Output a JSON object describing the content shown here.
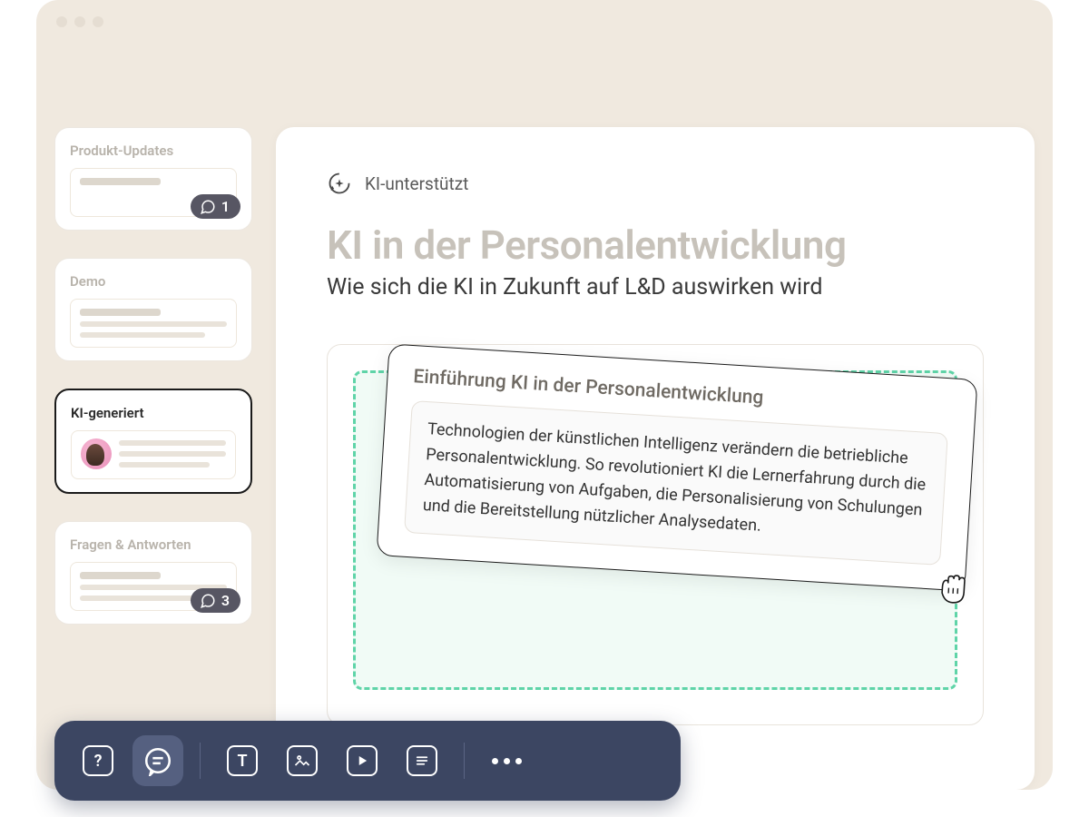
{
  "sidebar": {
    "items": [
      {
        "title": "Produkt-Updates",
        "comment_count": "1"
      },
      {
        "title": "Demo"
      },
      {
        "title": "KI-generiert"
      },
      {
        "title": "Fragen & Antworten",
        "comment_count": "3"
      }
    ]
  },
  "main": {
    "tag_label": "KI-unterstützt",
    "title": "KI in der Personalentwicklung",
    "subtitle": "Wie sich die KI in Zukunft auf L&D auswirken wird",
    "card": {
      "heading": "Einführung KI in der Personalentwicklung",
      "body": "Technologien der künstlichen Intelligenz verändern die betriebliche Personalentwicklung. So revolutioniert KI die Lernerfahrung durch die Automatisierung von Aufgaben, die Personalisierung von Schulungen und die Bereitstellung nützlicher Analysedaten."
    }
  },
  "toolbar": {
    "help": "?",
    "text": "T"
  }
}
